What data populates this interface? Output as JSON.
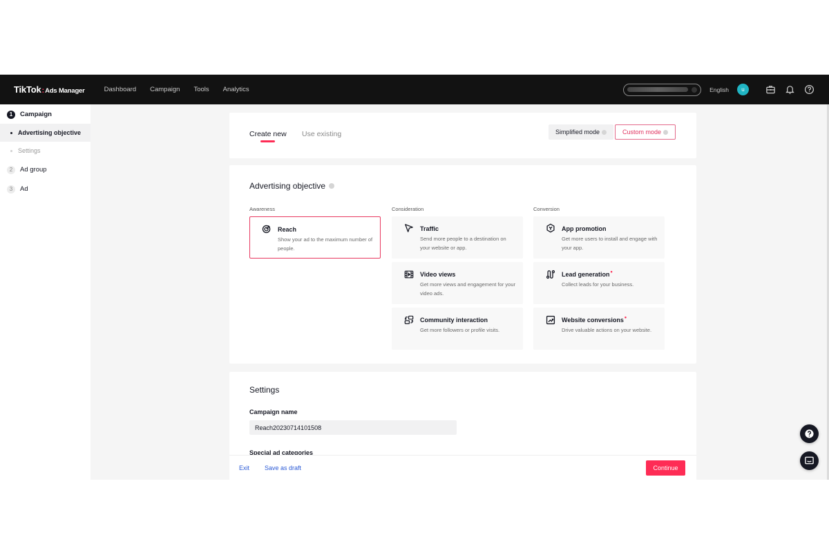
{
  "header": {
    "brand": "TikTok",
    "brand_separator": ":",
    "product": "Ads Manager",
    "nav": [
      {
        "label": "Dashboard"
      },
      {
        "label": "Campaign"
      },
      {
        "label": "Tools"
      },
      {
        "label": "Analytics"
      }
    ],
    "language": "English",
    "avatar_initial": "u",
    "icons": [
      "briefcase-icon",
      "bell-icon",
      "help-icon"
    ]
  },
  "sidebar": {
    "steps": [
      {
        "number": "1",
        "label": "Campaign",
        "active": true,
        "substeps": [
          {
            "label": "Advertising objective",
            "active": true
          },
          {
            "label": "Settings",
            "active": false
          }
        ]
      },
      {
        "number": "2",
        "label": "Ad group",
        "active": false
      },
      {
        "number": "3",
        "label": "Ad",
        "active": false
      }
    ]
  },
  "tabs": {
    "create_new": "Create new",
    "use_existing": "Use existing",
    "active": "Create new"
  },
  "modes": {
    "simplified": "Simplified mode",
    "custom": "Custom mode",
    "selected": "Custom mode"
  },
  "objective": {
    "title": "Advertising objective",
    "columns": [
      {
        "label": "Awareness",
        "items": [
          {
            "title": "Reach",
            "description": "Show your ad to the maximum number of people.",
            "icon": "target-icon",
            "selected": true,
            "required": false
          }
        ]
      },
      {
        "label": "Consideration",
        "items": [
          {
            "title": "Traffic",
            "description": "Send more people to a destination on your website or app.",
            "icon": "cursor-arrow-icon",
            "selected": false,
            "required": false
          },
          {
            "title": "Video views",
            "description": "Get more views and engagement for your video ads.",
            "icon": "video-film-icon",
            "selected": false,
            "required": false
          },
          {
            "title": "Community interaction",
            "description": "Get more followers or profile visits.",
            "icon": "community-swap-icon",
            "selected": false,
            "required": false
          }
        ]
      },
      {
        "label": "Conversion",
        "items": [
          {
            "title": "App promotion",
            "description": "Get more users to install and engage with your app.",
            "icon": "app-hexagon-icon",
            "selected": false,
            "required": false
          },
          {
            "title": "Lead generation",
            "description": "Collect leads for your business.",
            "icon": "lead-path-icon",
            "selected": false,
            "required": true
          },
          {
            "title": "Website conversions",
            "description": "Drive valuable actions on your website.",
            "icon": "trend-chart-icon",
            "selected": false,
            "required": true
          }
        ]
      }
    ]
  },
  "settings": {
    "title": "Settings",
    "campaign_name_label": "Campaign name",
    "campaign_name_value": "Reach20230714101508",
    "special_ad_categories_label": "Special ad categories"
  },
  "footer": {
    "exit": "Exit",
    "save_draft": "Save as draft",
    "continue": "Continue"
  },
  "colors": {
    "accent": "#fe2c55",
    "header_bg": "#121212",
    "link": "#2b5ad6",
    "avatar": "#20b5c4"
  }
}
